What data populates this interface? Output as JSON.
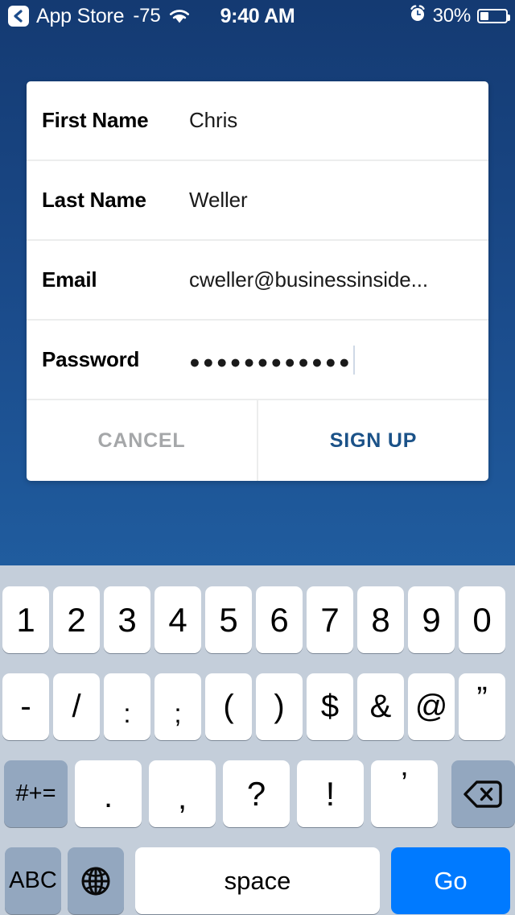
{
  "status_bar": {
    "back_icon": "chevron-left-icon",
    "app_name": "App Store",
    "signal": "-75",
    "wifi_icon": "wifi-icon",
    "time": "9:40 AM",
    "alarm_icon": "alarm-clock-icon",
    "battery_percent": "30%",
    "battery_level": 30
  },
  "dialog": {
    "fields": [
      {
        "label": "First Name",
        "value": "Chris"
      },
      {
        "label": "Last Name",
        "value": "Weller"
      },
      {
        "label": "Email",
        "value": "cweller@businessinside..."
      },
      {
        "label": "Password",
        "value": "●●●●●●●●●●●●"
      }
    ],
    "cancel_label": "CANCEL",
    "signup_label": "SIGN UP",
    "cancel_color": "#a5a7a9",
    "signup_color": "#1b5288"
  },
  "keyboard": {
    "row1": [
      "1",
      "2",
      "3",
      "4",
      "5",
      "6",
      "7",
      "8",
      "9",
      "0"
    ],
    "row2": [
      "-",
      "/",
      ":",
      ";",
      "(",
      ")",
      "$",
      "&",
      "@",
      "”"
    ],
    "row3": {
      "alt_symbols": "#+=",
      "punct": [
        ".",
        ",",
        "?",
        "!",
        "’"
      ],
      "backspace_icon": "backspace-icon"
    },
    "row4": {
      "abc": "ABC",
      "globe_icon": "globe-icon",
      "space": "space",
      "go": "Go"
    },
    "background_color": "#c4ceda",
    "key_color": "#ffffff",
    "modifier_key_color": "#93a7bf",
    "go_key_color": "#007aff"
  },
  "theme": {
    "background_top": "#143a72",
    "background_bottom": "#2465ab",
    "card_color": "#ffffff"
  }
}
